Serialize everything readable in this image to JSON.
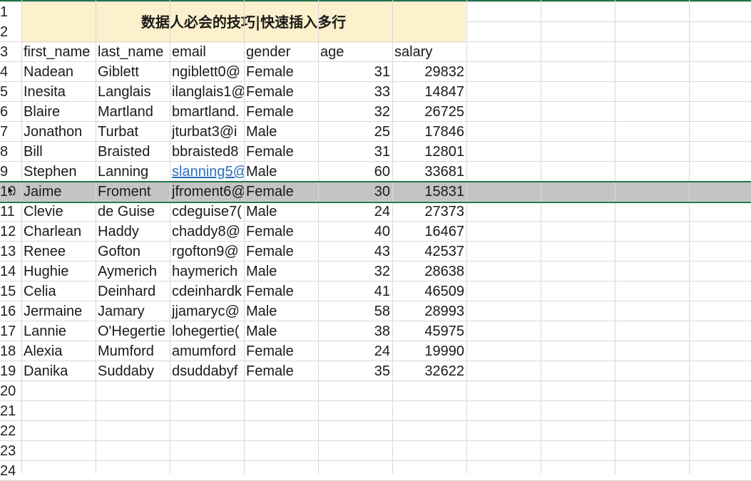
{
  "sheet": {
    "title": "数据人必会的技巧|快速插入多行",
    "headers": [
      "first_name",
      "last_name",
      "email",
      "gender",
      "age",
      "salary"
    ],
    "rows": [
      {
        "first_name": "Nadean",
        "last_name": "Giblett",
        "email": "ngiblett0@",
        "gender": "Female",
        "age": "31",
        "salary": "29832"
      },
      {
        "first_name": "Inesita",
        "last_name": "Langlais",
        "email": "ilanglais1@",
        "gender": "Female",
        "age": "33",
        "salary": "14847"
      },
      {
        "first_name": "Blaire",
        "last_name": "Martland",
        "email": "bmartland.",
        "gender": "Female",
        "age": "32",
        "salary": "26725"
      },
      {
        "first_name": "Jonathon",
        "last_name": "Turbat",
        "email": "jturbat3@i",
        "gender": "Male",
        "age": "25",
        "salary": "17846"
      },
      {
        "first_name": "Bill",
        "last_name": "Braisted",
        "email": "bbraisted8",
        "gender": "Female",
        "age": "31",
        "salary": "12801"
      },
      {
        "first_name": "Stephen",
        "last_name": "Lanning",
        "email": "slanning5@",
        "gender": "Male",
        "age": "60",
        "salary": "33681"
      },
      {
        "first_name": "Jaime",
        "last_name": "Froment",
        "email": "jfroment6@",
        "gender": "Female",
        "age": "30",
        "salary": "15831"
      },
      {
        "first_name": "Clevie",
        "last_name": "de Guise",
        "email": "cdeguise7(",
        "gender": "Male",
        "age": "24",
        "salary": "27373"
      },
      {
        "first_name": "Charlean",
        "last_name": "Haddy",
        "email": "chaddy8@",
        "gender": "Female",
        "age": "40",
        "salary": "16467"
      },
      {
        "first_name": "Renee",
        "last_name": "Gofton",
        "email": "rgofton9@",
        "gender": "Female",
        "age": "43",
        "salary": "42537"
      },
      {
        "first_name": "Hughie",
        "last_name": "Aymerich",
        "email": "haymerich",
        "gender": "Male",
        "age": "32",
        "salary": "28638"
      },
      {
        "first_name": "Celia",
        "last_name": "Deinhard",
        "email": "cdeinhardk",
        "gender": "Female",
        "age": "41",
        "salary": "46509"
      },
      {
        "first_name": "Jermaine",
        "last_name": "Jamary",
        "email": "jjamaryc@",
        "gender": "Male",
        "age": "58",
        "salary": "28993"
      },
      {
        "first_name": "Lannie",
        "last_name": "O'Hegertie",
        "email": "lohegertie(",
        "gender": "Male",
        "age": "38",
        "salary": "45975"
      },
      {
        "first_name": "Alexia",
        "last_name": "Mumford",
        "email": "amumford",
        "gender": "Female",
        "age": "24",
        "salary": "19990"
      },
      {
        "first_name": "Danika",
        "last_name": "Suddaby",
        "email": "dsuddabyf",
        "gender": "Female",
        "age": "35",
        "salary": "32622"
      }
    ],
    "row_numbers": [
      "1",
      "2",
      "3",
      "4",
      "5",
      "6",
      "7",
      "8",
      "9",
      "10",
      "11",
      "12",
      "13",
      "14",
      "15",
      "16",
      "17",
      "18",
      "19",
      "20",
      "21",
      "22",
      "23",
      "24"
    ],
    "selected_row": "10",
    "link_row": "9"
  },
  "colors": {
    "title_band": "#fdf0cc",
    "selection_fill": "#c4c4c4",
    "selection_border": "#217346",
    "link": "#2a6ebb"
  },
  "icons": {
    "row_select_cursor": "move-cursor-icon"
  }
}
